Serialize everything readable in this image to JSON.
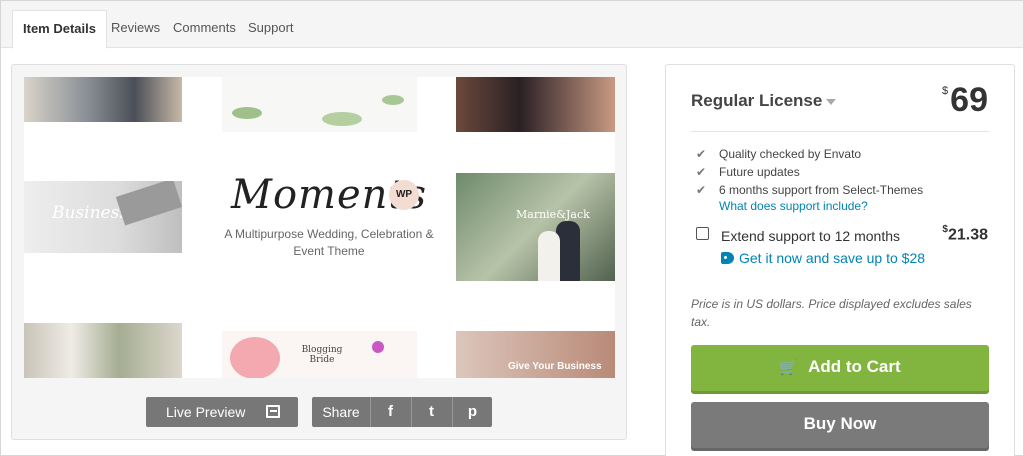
{
  "tabs": [
    "Item Details",
    "Reviews",
    "Comments",
    "Support"
  ],
  "preview": {
    "brand_name": "Moments",
    "wp_badge": "WP",
    "tagline": "A Multipurpose Wedding, Celebration & Event Theme",
    "tile_texts": {
      "business": "Business",
      "marnie": "Marnie&Jack",
      "blogging": "Blogging Bride",
      "give": "Give Your Business"
    },
    "live_preview_label": "Live Preview",
    "share_label": "Share",
    "share_facebook": "f",
    "share_twitter": "t",
    "share_pinterest": "p"
  },
  "license": {
    "name": "Regular License",
    "currency": "$",
    "price": "69",
    "features": [
      "Quality checked by Envato",
      "Future updates",
      "6 months support from Select-Themes"
    ],
    "support_link": "What does support include?",
    "extend_label": "Extend support to 12 months",
    "extend_currency": "$",
    "extend_price": "21.38",
    "save_text": "Get it now and save up to $28",
    "note": "Price is in US dollars. Price displayed excludes sales tax.",
    "add_to_cart": "Add to Cart",
    "buy_now": "Buy Now"
  },
  "colors": {
    "accent_green": "#82b440",
    "link_blue": "#0084b4",
    "buy_gray": "#7a7a7a"
  }
}
